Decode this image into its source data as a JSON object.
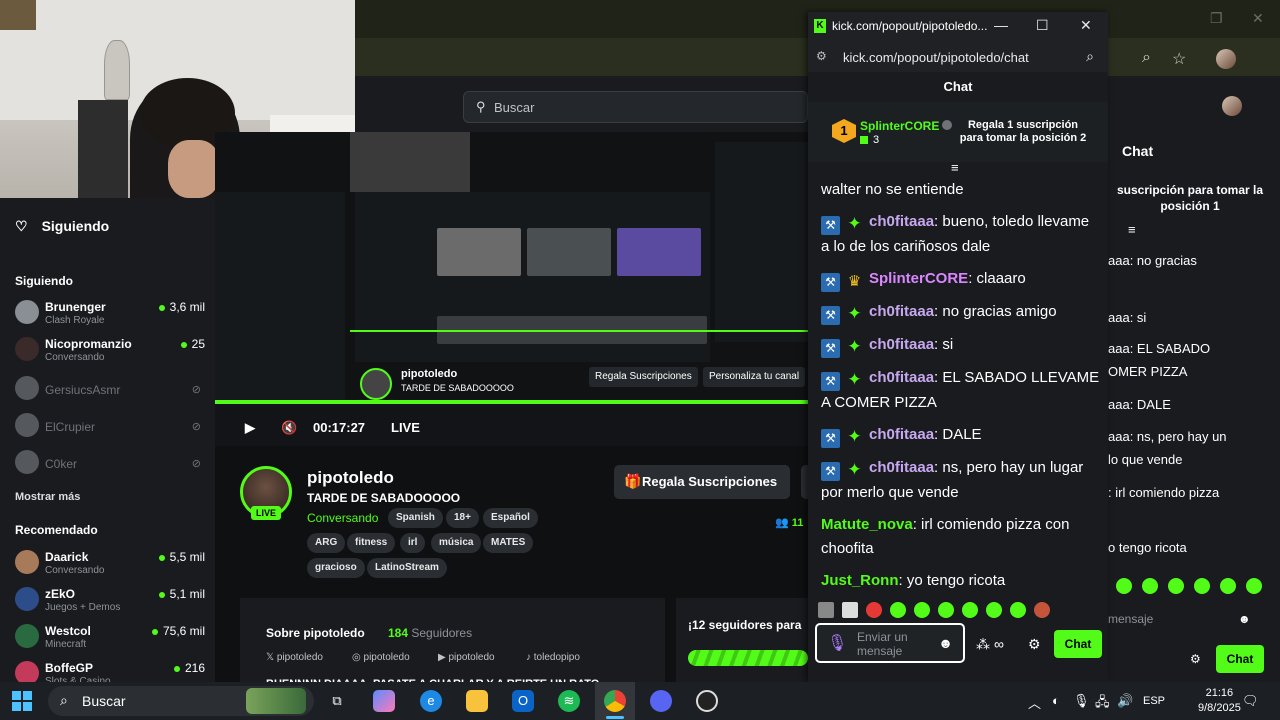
{
  "browser": {
    "url_popout_title": "kick.com/popout/pipotoledo...",
    "url_popout": "kick.com/popout/pipotoledo/chat",
    "search_placeholder": "Buscar"
  },
  "sidebar": {
    "following_title": "Siguiendo",
    "following_heading": "Siguiendo",
    "show_more": "Mostrar más",
    "recommended_heading": "Recomendado",
    "following": [
      {
        "name": "Brunenger",
        "category": "Clash Royale",
        "viewers": "3,6 mil",
        "online": true
      },
      {
        "name": "Nicopromanzio",
        "category": "Conversando",
        "viewers": "25",
        "online": true
      },
      {
        "name": "GersiucsAsmr",
        "online": false
      },
      {
        "name": "ElCrupier",
        "online": false
      },
      {
        "name": "C0ker",
        "online": false
      }
    ],
    "recommended": [
      {
        "name": "Daarick",
        "category": "Conversando",
        "viewers": "5,5 mil"
      },
      {
        "name": "zEkO",
        "category": "Juegos + Demos",
        "viewers": "5,1 mil"
      },
      {
        "name": "Westcol",
        "category": "Minecraft",
        "viewers": "75,6 mil"
      },
      {
        "name": "BoffeGP",
        "category": "Slots & Casino",
        "viewers": "216"
      }
    ]
  },
  "player": {
    "time": "00:17:27",
    "live": "LIVE",
    "nested_name": "pipotoledo",
    "nested_title": "TARDE DE SABADOOOOO",
    "nested_gift": "Regala Suscripciones",
    "nested_custom": "Personaliza tu canal"
  },
  "stream": {
    "name": "pipotoledo",
    "title": "TARDE DE SABADOOOOO",
    "category": "Conversando",
    "live_badge": "LIVE",
    "viewers": "11",
    "tags_row1": [
      "Spanish",
      "18+",
      "Español"
    ],
    "tags_row2": [
      "ARG",
      "fitness",
      "irl",
      "música",
      "MATES"
    ],
    "tags_row3": [
      "gracioso",
      "LatinoStream"
    ],
    "gift_button": "Regala Suscripciones",
    "about_title": "Sobre pipotoledo",
    "followers_count": "184",
    "followers_label": "Seguidores",
    "socials": [
      "pipotoledo",
      "pipotoledo",
      "pipotoledo",
      "toledopipo"
    ],
    "about_text": "BUENNNN DIAAAA, PASATE A CHARLAR Y A REIRTE UN RATO",
    "goal_text": "¡12 seguidores para"
  },
  "popout_chat": {
    "header": "Chat",
    "pinned": {
      "rank": "1",
      "user": "SplinterCORE",
      "count": "3",
      "text": "Regala 1 suscripción para tomar la posición 2"
    },
    "messages": [
      {
        "user": "",
        "text": "walter no se entiende",
        "badges": [],
        "color": ""
      },
      {
        "user": "ch0fitaaa",
        "text": ": bueno, toledo llevame a lo de los cariñosos dale",
        "badges": [
          "ax",
          "star"
        ],
        "color": "purple"
      },
      {
        "user": "SplinterCORE",
        "text": ": claaaro",
        "badges": [
          "ax",
          "crown"
        ],
        "color": "pink"
      },
      {
        "user": "ch0fitaaa",
        "text": ": no gracias amigo",
        "badges": [
          "ax",
          "star"
        ],
        "color": "purple"
      },
      {
        "user": "ch0fitaaa",
        "text": ": si",
        "badges": [
          "ax",
          "star"
        ],
        "color": "purple"
      },
      {
        "user": "ch0fitaaa",
        "text": ": EL SABADO LLEVAME A COMER PIZZA",
        "badges": [
          "ax",
          "star"
        ],
        "color": "purple"
      },
      {
        "user": "ch0fitaaa",
        "text": ": DALE",
        "badges": [
          "ax",
          "star"
        ],
        "color": "purple"
      },
      {
        "user": "ch0fitaaa",
        "text": ": ns, pero hay un lugar por merlo que vende",
        "badges": [
          "ax",
          "star"
        ],
        "color": "purple"
      },
      {
        "user": "Matute_nova",
        "text": ": irl comiendo pizza con choofita",
        "badges": [],
        "color": "green"
      },
      {
        "user": "Just_Ronn",
        "text": ": yo tengo ricota",
        "badges": [],
        "color": "green"
      }
    ],
    "input_placeholder": "Enviar un mensaje",
    "send": "Chat"
  },
  "bg_chat": {
    "header": "Chat",
    "pinned": "suscripción para tomar la posición 1",
    "lines": [
      "aaa: no gracias",
      "aaa: si",
      "aaa: EL SABADO",
      "OMER PIZZA",
      "aaa: DALE",
      "aaa: ns, pero hay un",
      "lo que vende",
      ": irl comiendo pizza",
      "o tengo ricota"
    ],
    "input_placeholder": "mensaje",
    "send": "Chat"
  },
  "taskbar": {
    "search": "Buscar",
    "lang": "ESP",
    "time": "21:16",
    "date": "9/8/2025"
  },
  "colors": {
    "kick_green": "#53fc18",
    "chat_purple": "#c7a8f0",
    "bg_dark": "#191b1f"
  }
}
